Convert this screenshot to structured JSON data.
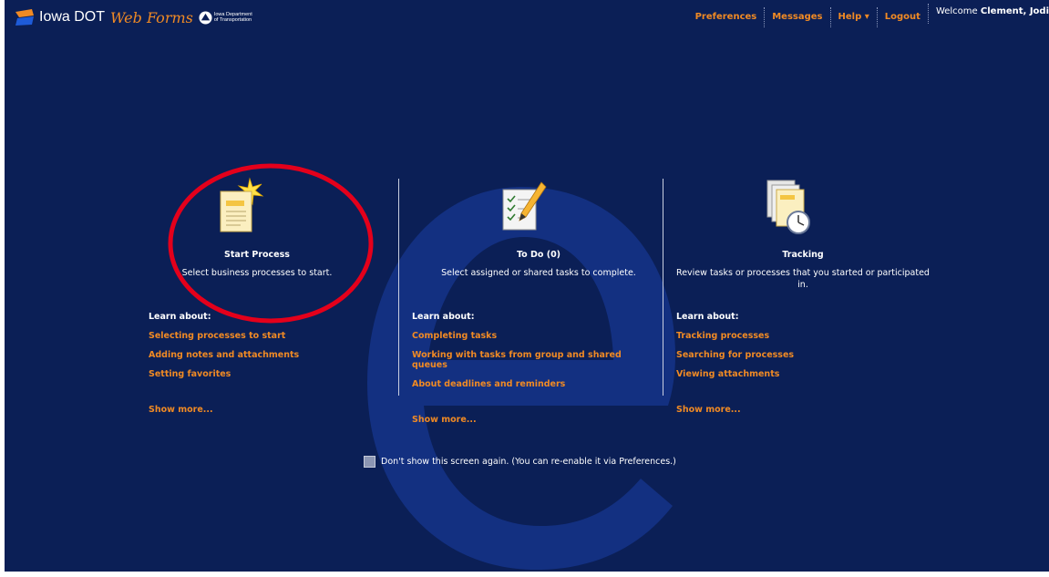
{
  "header": {
    "logo_text": "Iowa DOT",
    "logo_script": "Web Forms",
    "logo_sub_line1": "Iowa Department",
    "logo_sub_line2": "of Transportation",
    "nav": {
      "preferences": "Preferences",
      "messages": "Messages",
      "help": "Help",
      "logout": "Logout"
    },
    "welcome_prefix": "Welcome",
    "user_name": "Clement, Jodi"
  },
  "columns": [
    {
      "icon": "start-process-icon",
      "title": "Start Process",
      "description": "Select business processes to start.",
      "learn_about": "Learn about:",
      "links": [
        "Selecting processes to start",
        "Adding notes and attachments",
        "Setting favorites"
      ],
      "show_more": "Show more..."
    },
    {
      "icon": "todo-checklist-icon",
      "title": "To Do (0)",
      "description": "Select assigned or shared tasks to complete.",
      "learn_about": "Learn about:",
      "links": [
        "Completing tasks",
        "Working with tasks from group and shared queues",
        "About deadlines and reminders"
      ],
      "show_more": "Show more..."
    },
    {
      "icon": "tracking-clock-icon",
      "title": "Tracking",
      "description": "Review tasks or processes that you started or participated in.",
      "learn_about": "Learn about:",
      "links": [
        "Tracking processes",
        "Searching for processes",
        "Viewing attachments"
      ],
      "show_more": "Show more..."
    }
  ],
  "dont_show": "Don't show this screen again. (You can re-enable it via Preferences.)",
  "colors": {
    "background": "#0b1f56",
    "accent_orange": "#f08a24",
    "highlight_circle": "#e4001b"
  }
}
